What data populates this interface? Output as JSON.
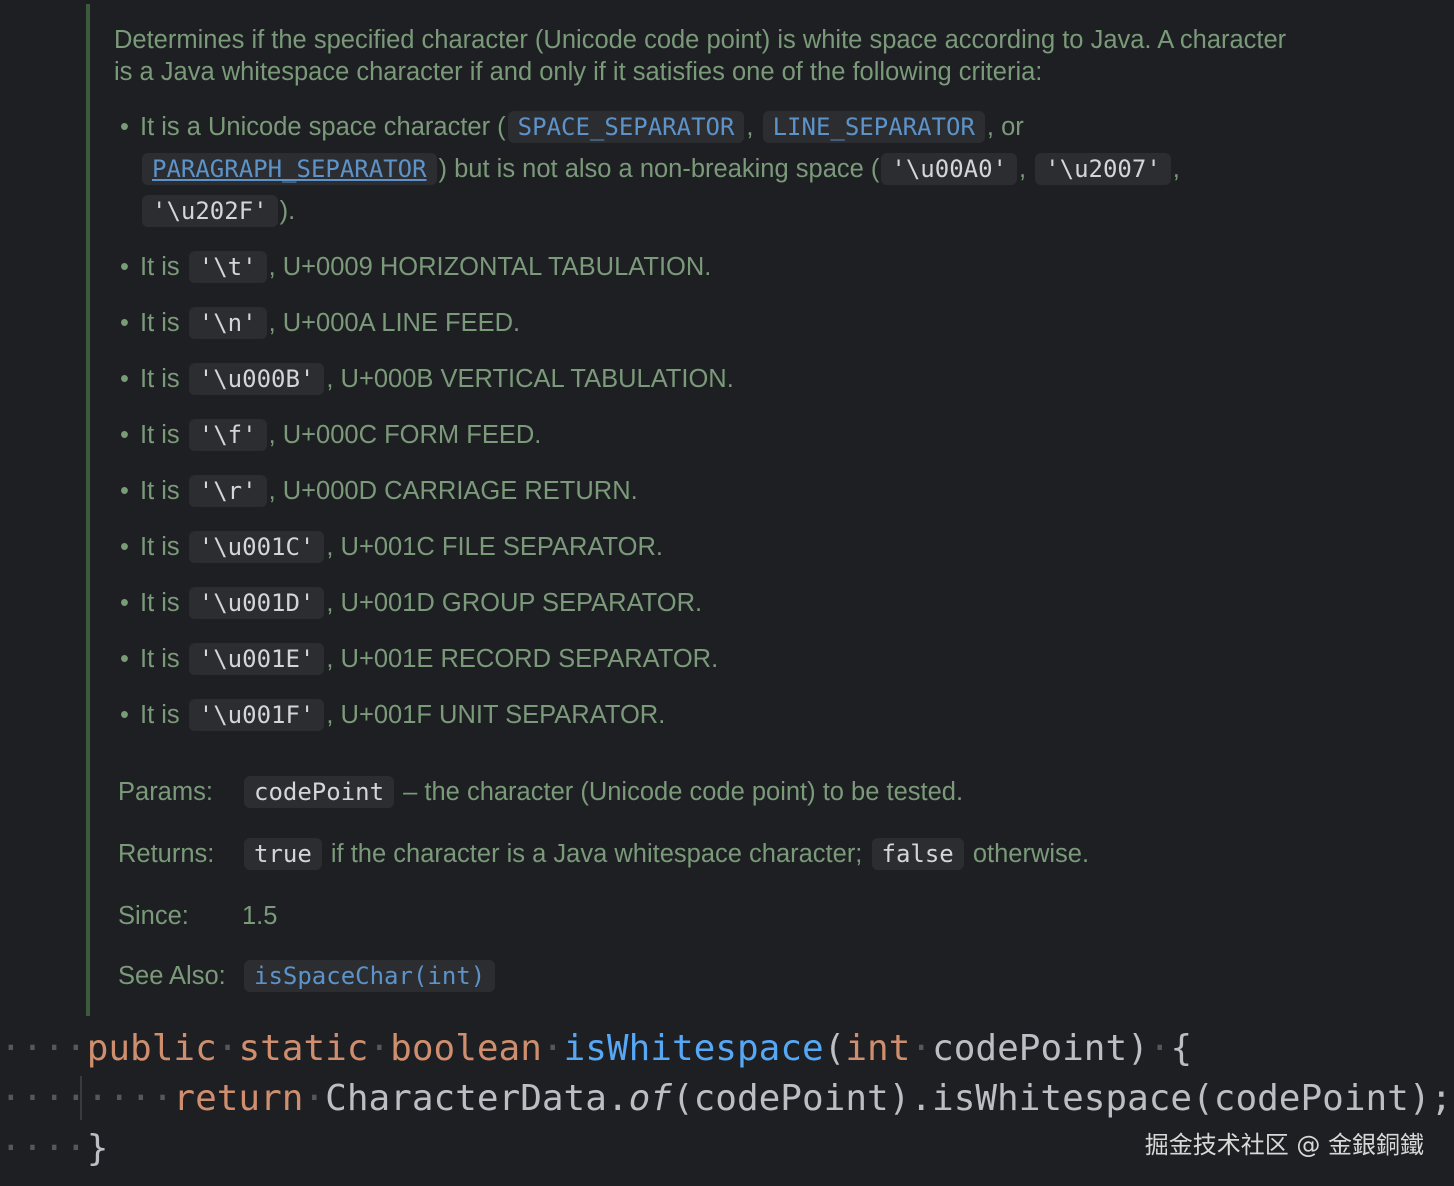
{
  "doc": {
    "intro": "Determines if the specified character (Unicode code point) is white space according to Java. A character is a Java whitespace character if and only if it satisfies one of the following criteria:",
    "bullet_dot": "•",
    "first_bullet": {
      "prefix": "It is a Unicode space character (",
      "code1": "SPACE_SEPARATOR",
      "sep1": ",",
      "code2": "LINE_SEPARATOR",
      "sep2": ", or",
      "code3": "PARAGRAPH_SEPARATOR",
      "mid": ") but is not also a non-breaking space (",
      "code4": "'\\u00A0'",
      "sep3": ",",
      "code5": "'\\u2007'",
      "sep4": ",",
      "code6": "'\\u202F'",
      "suffix": ")."
    },
    "items": [
      {
        "prefix": "It is",
        "code": "'\\t'",
        "desc": ", U+0009 HORIZONTAL TABULATION."
      },
      {
        "prefix": "It is",
        "code": "'\\n'",
        "desc": ", U+000A LINE FEED."
      },
      {
        "prefix": "It is",
        "code": "'\\u000B'",
        "desc": ", U+000B VERTICAL TABULATION."
      },
      {
        "prefix": "It is",
        "code": "'\\f'",
        "desc": ", U+000C FORM FEED."
      },
      {
        "prefix": "It is",
        "code": "'\\r'",
        "desc": ", U+000D CARRIAGE RETURN."
      },
      {
        "prefix": "It is",
        "code": "'\\u001C'",
        "desc": ", U+001C FILE SEPARATOR."
      },
      {
        "prefix": "It is",
        "code": "'\\u001D'",
        "desc": ", U+001D GROUP SEPARATOR."
      },
      {
        "prefix": "It is",
        "code": "'\\u001E'",
        "desc": ", U+001E RECORD SEPARATOR."
      },
      {
        "prefix": "It is",
        "code": "'\\u001F'",
        "desc": ", U+001F UNIT SEPARATOR."
      }
    ],
    "params": {
      "label": "Params:",
      "code": "codePoint",
      "desc": "– the character (Unicode code point) to be tested."
    },
    "returns": {
      "label": "Returns:",
      "code1": "true",
      "mid": "if the character is a Java whitespace character;",
      "code2": "false",
      "desc": "otherwise."
    },
    "since": {
      "label": "Since:",
      "value": "1.5"
    },
    "see_also": {
      "label": "See Also:",
      "link": "isSpaceChar(int)"
    }
  },
  "code": {
    "line1": {
      "ws": "····",
      "kw1": "public",
      "kw2": "static",
      "kw3": "boolean",
      "name": "isWhitespace",
      "open": "(",
      "kw4": "int",
      "param": "codePoint",
      "close": ")",
      "brace": "{"
    },
    "line2": {
      "ws1": "····",
      "ws2": "····",
      "kw": "return",
      "cls": "CharacterData.",
      "method": "of",
      "rest": "(codePoint).isWhitespace(codePoint);"
    },
    "line3": {
      "ws": "····",
      "brace": "}"
    }
  },
  "watermark": "掘金技术社区 @ 金銀銅鐵"
}
